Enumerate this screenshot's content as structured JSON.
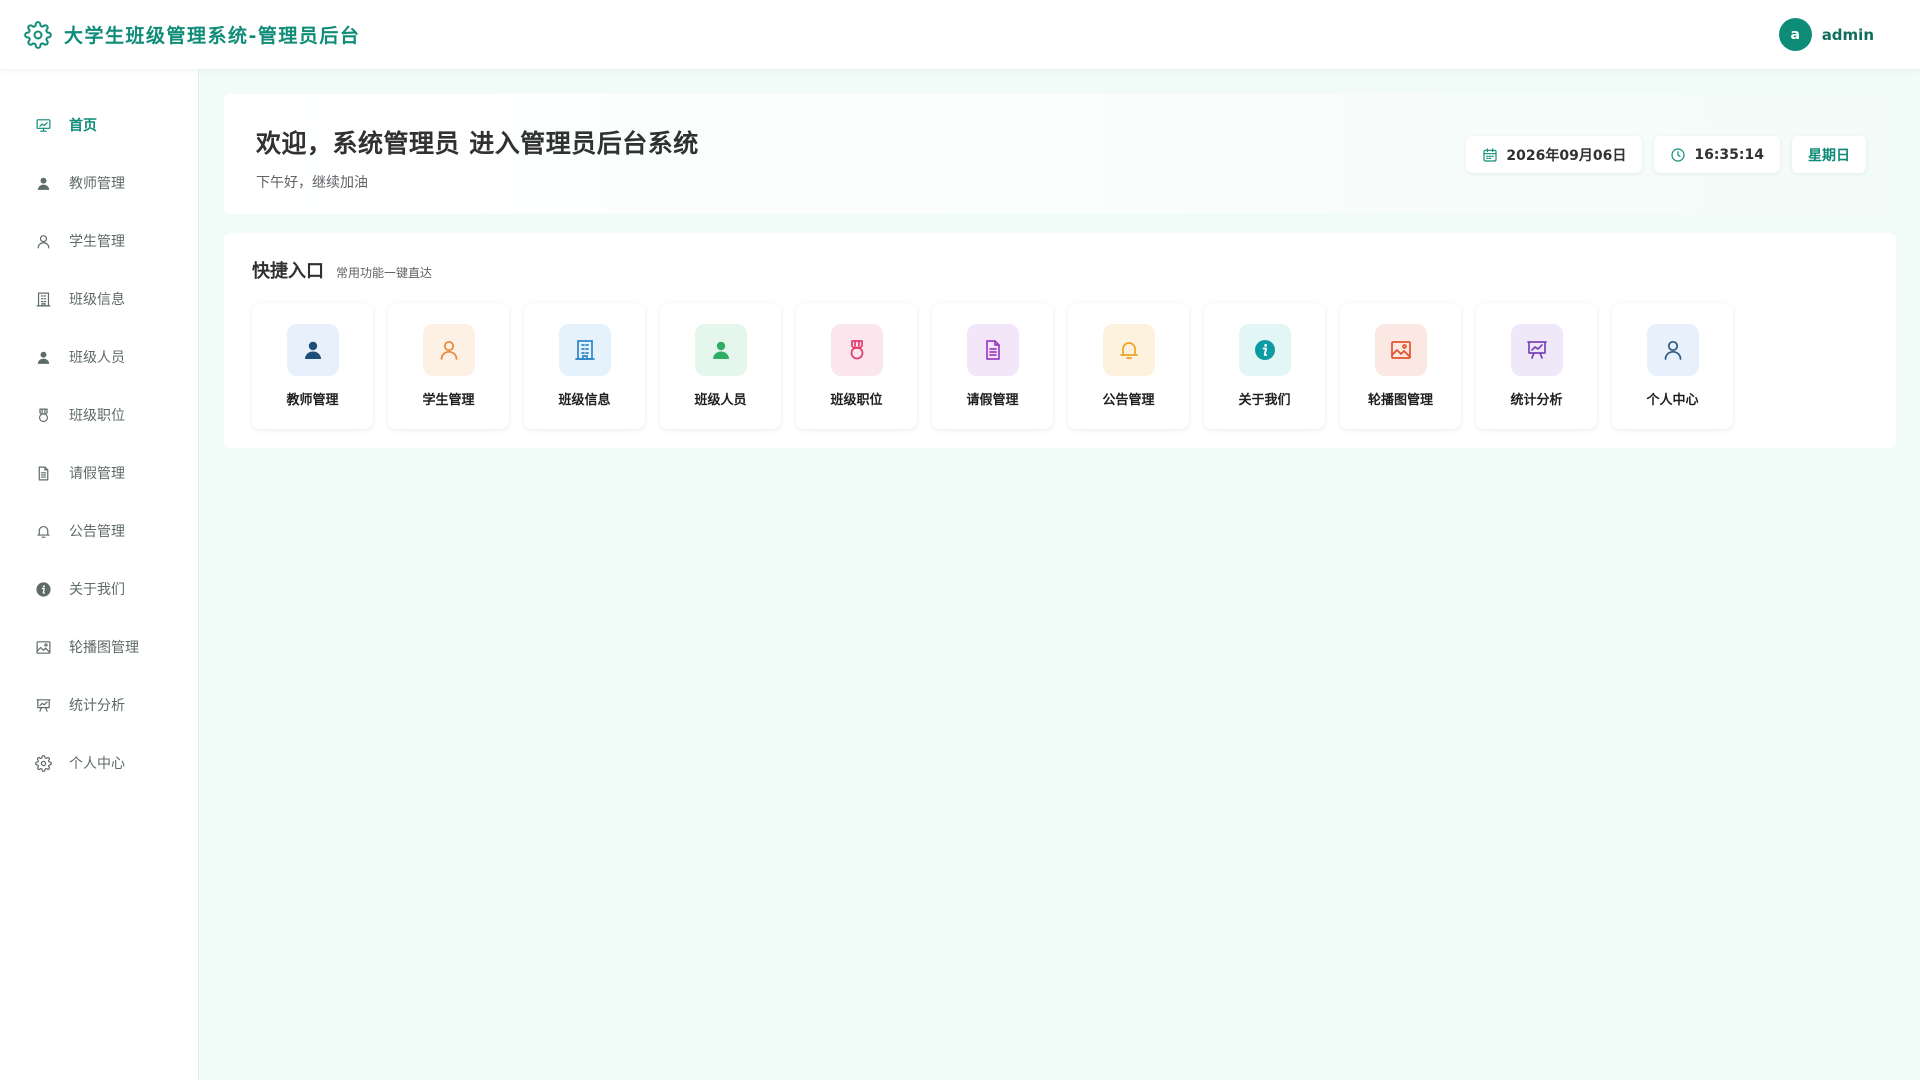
{
  "header": {
    "title": "大学生班级管理系统-管理员后台",
    "avatar_letter": "a",
    "username": "admin"
  },
  "sidebar": {
    "items": [
      {
        "label": "首页",
        "icon": "dashboard-icon",
        "active": true
      },
      {
        "label": "教师管理",
        "icon": "user-filled-icon"
      },
      {
        "label": "学生管理",
        "icon": "user-outline-icon"
      },
      {
        "label": "班级信息",
        "icon": "building-icon"
      },
      {
        "label": "班级人员",
        "icon": "user-filled-icon"
      },
      {
        "label": "班级职位",
        "icon": "medal-icon"
      },
      {
        "label": "请假管理",
        "icon": "document-icon"
      },
      {
        "label": "公告管理",
        "icon": "bell-icon"
      },
      {
        "label": "关于我们",
        "icon": "info-icon"
      },
      {
        "label": "轮播图管理",
        "icon": "picture-icon"
      },
      {
        "label": "统计分析",
        "icon": "presentation-icon"
      },
      {
        "label": "个人中心",
        "icon": "gear-icon"
      }
    ]
  },
  "welcome": {
    "title": "欢迎，系统管理员 进入管理员后台系统",
    "subtitle": "下午好，继续加油",
    "date": "2026年09月06日",
    "time": "16:35:14",
    "weekday": "星期日"
  },
  "quick": {
    "title": "快捷入口",
    "subtitle": "常用功能一键直达",
    "tiles": [
      {
        "label": "教师管理",
        "icon": "user-filled-icon",
        "color": "#1f4e79",
        "bg": "#e8f1fb"
      },
      {
        "label": "学生管理",
        "icon": "user-outline-icon",
        "color": "#e8883a",
        "bg": "#fdf0e4"
      },
      {
        "label": "班级信息",
        "icon": "building-icon",
        "color": "#2f86c8",
        "bg": "#e6f2fb"
      },
      {
        "label": "班级人员",
        "icon": "user-filled-icon",
        "color": "#2fae66",
        "bg": "#e5f6ec"
      },
      {
        "label": "班级职位",
        "icon": "medal-icon",
        "color": "#e23b6e",
        "bg": "#fbe6ee"
      },
      {
        "label": "请假管理",
        "icon": "document-icon",
        "color": "#9b3fc4",
        "bg": "#f3e6f9"
      },
      {
        "label": "公告管理",
        "icon": "bell-icon",
        "color": "#eea223",
        "bg": "#fdf2dd"
      },
      {
        "label": "关于我们",
        "icon": "info-icon",
        "color": "#0e9aa3",
        "bg": "#e2f6f6"
      },
      {
        "label": "轮播图管理",
        "icon": "picture-icon",
        "color": "#e2542c",
        "bg": "#fce8e3"
      },
      {
        "label": "统计分析",
        "icon": "presentation-icon",
        "color": "#7a45b8",
        "bg": "#efe8f8"
      },
      {
        "label": "个人中心",
        "icon": "user-outline-icon",
        "color": "#2c5a7f",
        "bg": "#e8f1fb"
      }
    ]
  }
}
